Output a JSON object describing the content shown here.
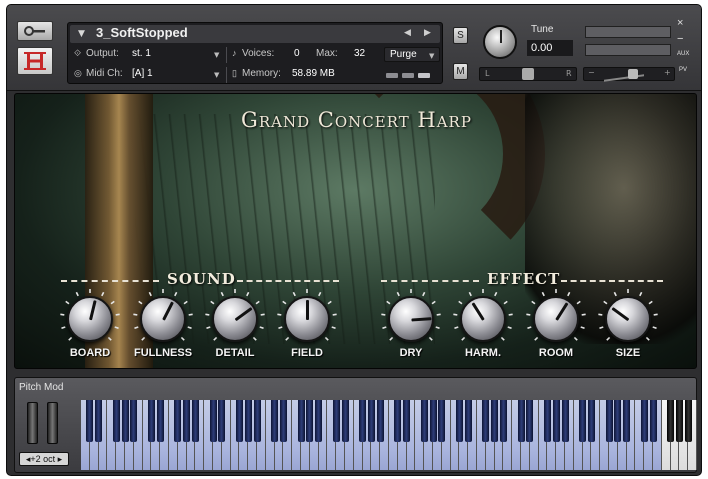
{
  "header": {
    "instrument_name": "3_SoftStopped",
    "output_label": "Output:",
    "output_value": "st. 1",
    "voices_label": "Voices:",
    "voices_value": "0",
    "max_label": "Max:",
    "max_value": "32",
    "purge_label": "Purge",
    "midi_label": "Midi Ch:",
    "midi_value": "[A]  1",
    "memory_label": "Memory:",
    "memory_value": "58.89 MB",
    "solo_label": "S",
    "mute_label": "M",
    "tune_label": "Tune",
    "tune_value": "0.00",
    "pan_left": "L",
    "pan_right": "R",
    "vol_minus": "−",
    "vol_plus": "+",
    "close_label": "×",
    "minimize_label": "−",
    "aux_label": "AUX",
    "pv_label": "PV"
  },
  "panel": {
    "title": "Grand Concert Harp",
    "sections": [
      {
        "title": "SOUND"
      },
      {
        "title": "EFFECT"
      }
    ],
    "knobs": [
      {
        "label": "BOARD",
        "value": 0.55
      },
      {
        "label": "FULLNESS",
        "value": 0.6
      },
      {
        "label": "DETAIL",
        "value": 0.7
      },
      {
        "label": "FIELD",
        "value": 0.5
      },
      {
        "label": "DRY",
        "value": 0.82
      },
      {
        "label": "HARM.",
        "value": 0.38
      },
      {
        "label": "ROOM",
        "value": 0.62
      },
      {
        "label": "SIZE",
        "value": 0.3
      }
    ]
  },
  "keyboard": {
    "pitch_label": "Pitch Mod",
    "octave_label": "◂+2 oct ▸"
  },
  "colors": {
    "frame": "#2e2e30",
    "accent_blue": "#aab5de",
    "panel_green": "#2f4536"
  }
}
